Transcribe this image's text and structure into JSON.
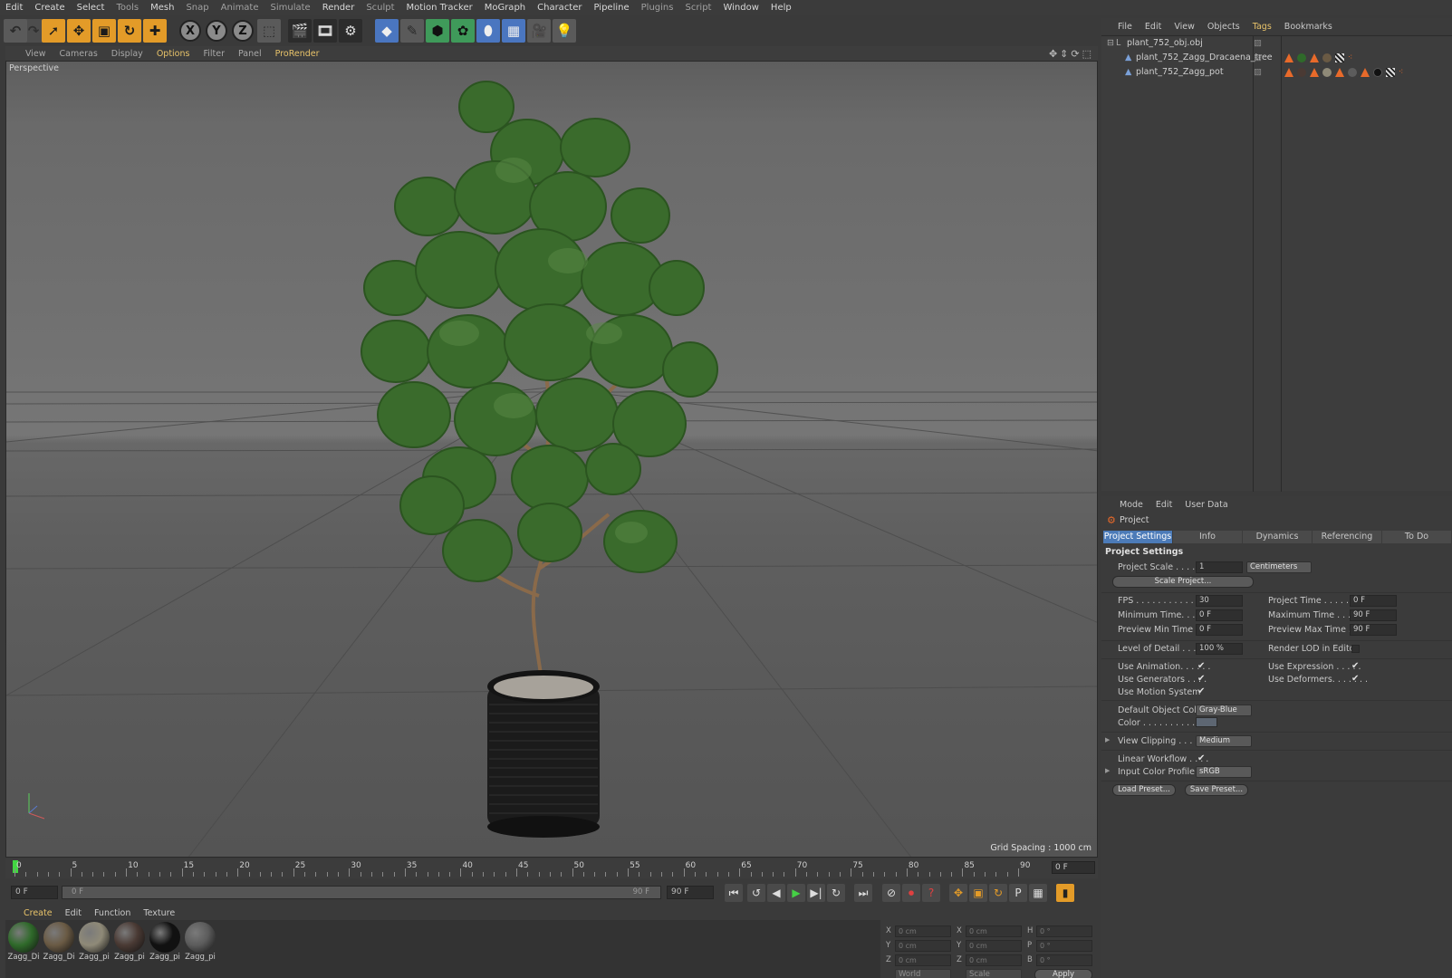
{
  "menu": [
    "Edit",
    "Create",
    "Select",
    "Tools",
    "Mesh",
    "Snap",
    "Animate",
    "Simulate",
    "Render",
    "Sculpt",
    "Motion Tracker",
    "MoGraph",
    "Character",
    "Pipeline",
    "Plugins",
    "Script",
    "Window",
    "Help"
  ],
  "viewport": {
    "menu": [
      "View",
      "Cameras",
      "Display",
      "Options",
      "Filter",
      "Panel",
      "ProRender"
    ],
    "label": "Perspective",
    "grid_spacing": "Grid Spacing : 1000 cm"
  },
  "timeline": {
    "ticks": [
      "0",
      "5",
      "10",
      "15",
      "20",
      "25",
      "30",
      "35",
      "40",
      "45",
      "50",
      "55",
      "60",
      "65",
      "70",
      "75",
      "80",
      "85",
      "90"
    ],
    "current_frame": "0 F",
    "start": "0 F",
    "range_start": "0 F",
    "range_end": "90 F",
    "end": "90 F"
  },
  "materials": {
    "menu": [
      "Create",
      "Edit",
      "Function",
      "Texture"
    ],
    "items": [
      {
        "label": "Zagg_Di",
        "color": "#2f6a2a"
      },
      {
        "label": "Zagg_Di",
        "color": "#6a5a44"
      },
      {
        "label": "Zagg_pi",
        "color": "#8f8a78"
      },
      {
        "label": "Zagg_pi",
        "color": "#4a3a34"
      },
      {
        "label": "Zagg_pi",
        "color": "#111111"
      },
      {
        "label": "Zagg_pi",
        "color": "#5c5c5c"
      }
    ]
  },
  "coords": {
    "rows": [
      {
        "a": "X",
        "av": "0 cm",
        "b": "X",
        "bv": "0 cm",
        "c": "H",
        "cv": "0 °"
      },
      {
        "a": "Y",
        "av": "0 cm",
        "b": "Y",
        "bv": "0 cm",
        "c": "P",
        "cv": "0 °"
      },
      {
        "a": "Z",
        "av": "0 cm",
        "b": "Z",
        "bv": "0 cm",
        "c": "B",
        "cv": "0 °"
      }
    ],
    "mode1": "World",
    "mode2": "Scale",
    "apply": "Apply"
  },
  "object_manager": {
    "menu": [
      "File",
      "Edit",
      "View",
      "Objects",
      "Tags",
      "Bookmarks"
    ],
    "objects": [
      "plant_752_obj.obj",
      "plant_752_Zagg_Dracaena_tree",
      "plant_752_Zagg_pot"
    ]
  },
  "attributes": {
    "menu": [
      "Mode",
      "Edit",
      "User Data"
    ],
    "title": "Project",
    "tabs": [
      "Project Settings",
      "Info",
      "Dynamics",
      "Referencing",
      "To Do"
    ],
    "section": "Project Settings",
    "project_scale_label": "Project Scale . . . . . .",
    "project_scale": "1",
    "units": "Centimeters",
    "scale_project": "Scale Project...",
    "fps_label": "FPS . . . . . . . . . . . . . .",
    "fps": "30",
    "project_time_label": "Project Time . . . . . . . .",
    "project_time": "0 F",
    "min_time_label": "Minimum Time. . . . .",
    "min_time": "0 F",
    "max_time_label": "Maximum Time . . . . .",
    "max_time": "90 F",
    "prev_min_label": "Preview Min Time . .",
    "prev_min": "0 F",
    "prev_max_label": "Preview Max Time . . .",
    "prev_max": "90 F",
    "lod_label": "Level of Detail . . . . .",
    "lod": "100 %",
    "render_lod_label": "Render LOD in Editor",
    "use_anim": "Use Animation. . . . . .",
    "use_expr": "Use Expression . . . . .",
    "use_gen": "Use Generators . . . .",
    "use_def": "Use Deformers. . . . . . .",
    "use_motion": "Use Motion System",
    "default_color_label": "Default Object Color",
    "default_color": "Gray-Blue",
    "color_label": "Color . . . . . . . . . . . . .",
    "swatch_color": "#5d6672",
    "view_clipping_label": "View Clipping . . . . .",
    "view_clipping": "Medium",
    "linear_label": "Linear Workflow . . . .",
    "input_profile_label": "Input Color Profile . .",
    "input_profile": "sRGB",
    "load_preset": "Load Preset...",
    "save_preset": "Save Preset..."
  }
}
